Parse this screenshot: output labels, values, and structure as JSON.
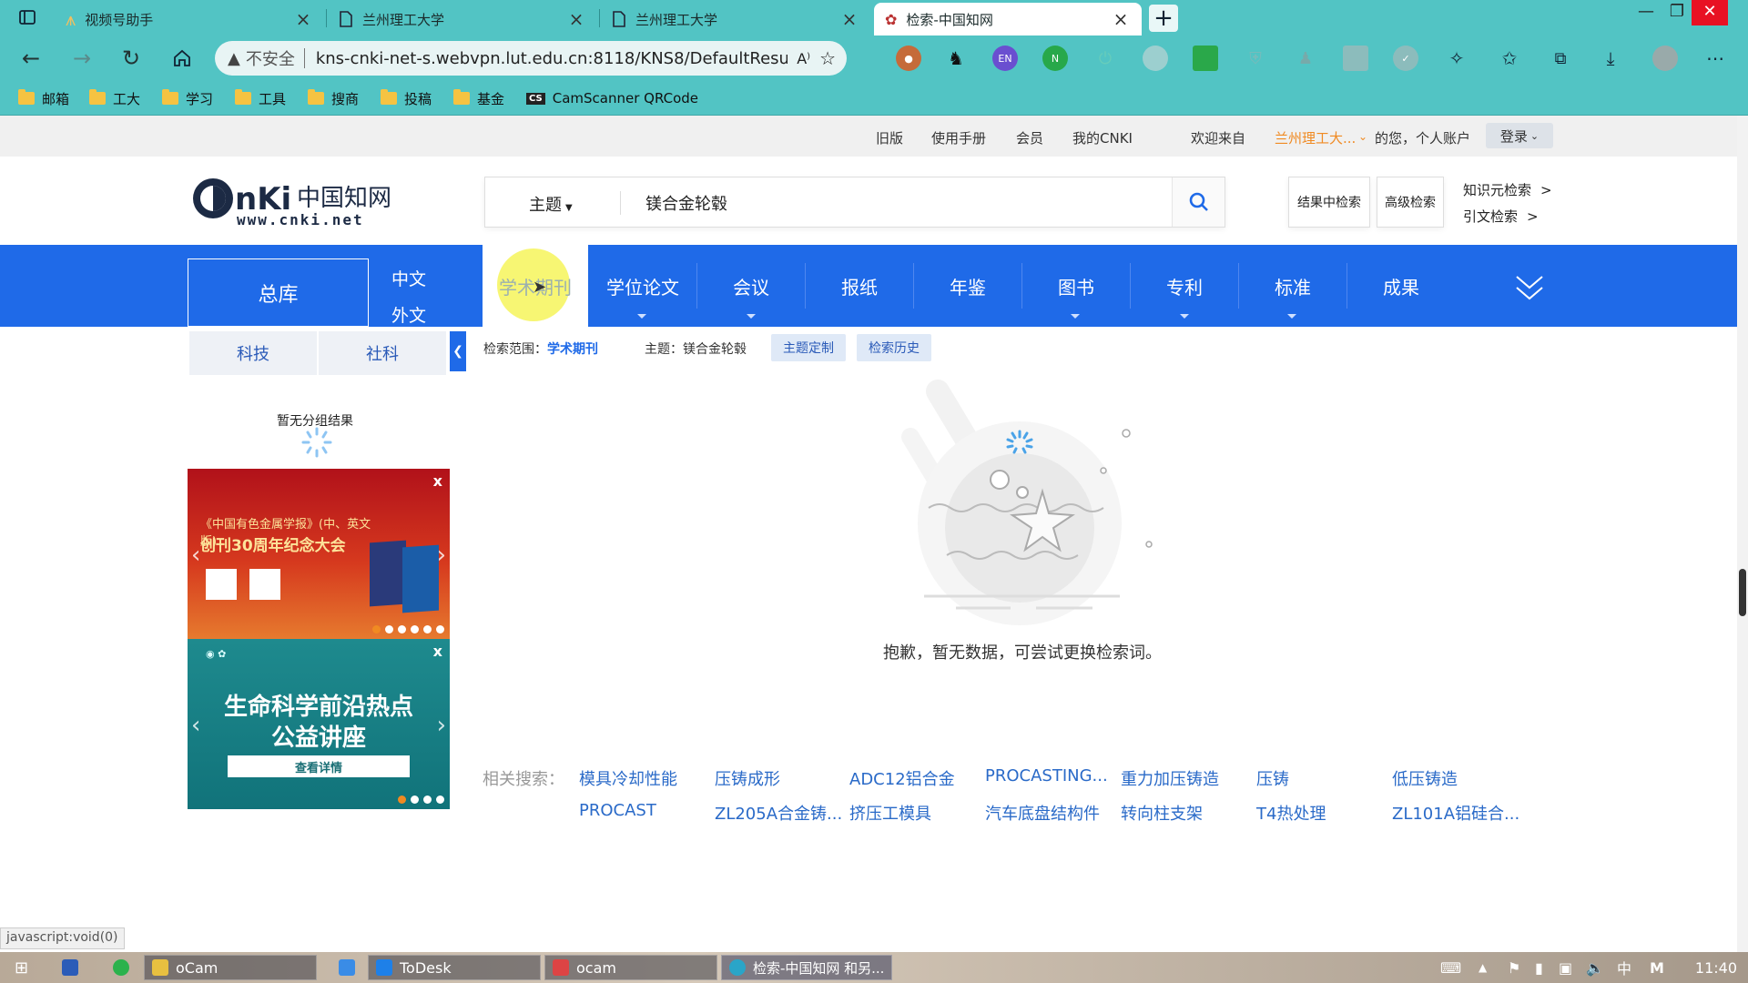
{
  "browser": {
    "tabs": [
      {
        "title": "视频号助手",
        "active": false
      },
      {
        "title": "兰州理工大学",
        "active": false
      },
      {
        "title": "兰州理工大学",
        "active": false
      },
      {
        "title": "检索-中国知网",
        "active": true
      }
    ],
    "new_tab": "+",
    "window_controls": {
      "minimize": "—",
      "restore": "❐",
      "close": "✕"
    },
    "address": {
      "security": "不安全",
      "url": "kns-cnki-net-s.webvpn.lut.edu.cn:8118/KNS8/DefaultResult/In..."
    },
    "bookmarks": [
      "邮箱",
      "工大",
      "学习",
      "工具",
      "搜商",
      "投稿",
      "基金",
      "CamScanner QRCode"
    ],
    "bookmark_cs_badge": "CS"
  },
  "page": {
    "top_links": [
      "旧版",
      "使用手册",
      "会员",
      "我的CNKI"
    ],
    "welcome": "欢迎来自",
    "institution": "兰州理工大...",
    "account_suffix": "的您，个人账户",
    "login": "登录",
    "logo_text": "www.cnki.net",
    "search": {
      "field": "主题",
      "query": "镁合金轮毂"
    },
    "search_in_results": "结果中检索",
    "advanced_search": "高级检索",
    "knowledge_search": "知识元检索",
    "citation_search": "引文检索",
    "db_all": "总库",
    "lang_zh": "中文",
    "lang_en": "外文",
    "db_tabs": [
      "学术期刊",
      "学位论文",
      "会议",
      "报纸",
      "年鉴",
      "图书",
      "专利",
      "标准",
      "成果"
    ],
    "sub_tabs": [
      "科技",
      "社科"
    ],
    "scope_label": "检索范围：",
    "scope_value": "学术期刊",
    "topic_label": "主题：镁合金轮毂",
    "topic_customize": "主题定制",
    "search_history": "检索历史",
    "no_group": "暂无分组结果",
    "banner1": {
      "line1": "《中国有色金属学报》(中、英文版)",
      "line2": "创刊30周年纪念大会"
    },
    "banner2": {
      "line1": "生命科学前沿热点",
      "line2": "公益讲座",
      "button": "查看详情"
    },
    "banner_close": "x",
    "empty_message": "抱歉，暂无数据，可尝试更换检索词。",
    "related_label": "相关搜索：",
    "related": [
      "模具冷却性能",
      "压铸成形",
      "ADC12铝合金",
      "PROCASTING...",
      "重力加压铸造",
      "压铸",
      "低压铸造",
      "PROCAST",
      "ZL205A合金铸...",
      "挤压工模具",
      "汽车底盘结构件",
      "转向柱支架",
      "T4热处理",
      "ZL101A铝硅合..."
    ]
  },
  "status_url": "javascript:void(0)",
  "taskbar": {
    "items": [
      "oCam",
      "ToDesk",
      "ocam",
      "检索-中国知网 和另..."
    ],
    "tray_ime": "中",
    "tray_m": "M",
    "clock": "11:40"
  }
}
